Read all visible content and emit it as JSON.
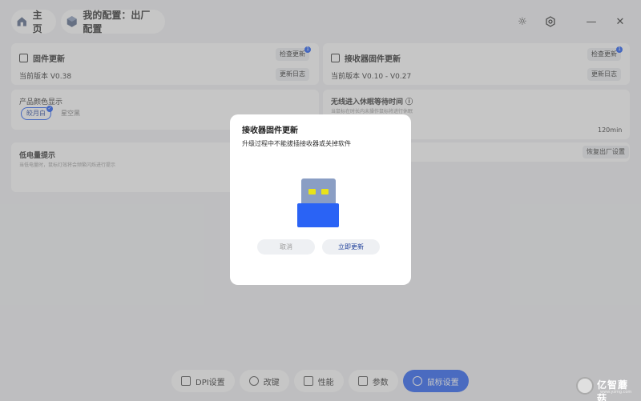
{
  "topbar": {
    "home_label": "主页",
    "config_label": "我的配置：出厂配置",
    "icons": [
      "brightness-icon",
      "settings-icon",
      "minimize-icon",
      "close-icon"
    ],
    "minimize_glyph": "—",
    "close_glyph": "✕",
    "sun_glyph": "☼",
    "gear_glyph": "⚙"
  },
  "firmware": {
    "title": "固件更新",
    "check_label": "检查更新",
    "badge": "1",
    "version": "当前版本 V0.38",
    "log_label": "更新日志"
  },
  "receiver": {
    "title": "接收器固件更新",
    "check_label": "检查更新",
    "badge": "1",
    "version": "当前版本 V0.10 - V0.27",
    "log_label": "更新日志"
  },
  "color_display": {
    "title": "产品颜色显示",
    "options": [
      "皎月白",
      "星空黑"
    ],
    "selected": "皎月白"
  },
  "sleep": {
    "title": "无线进入休眠等待时间",
    "info_glyph": "ⓘ",
    "hint": "当鼠标在时长内未操作鼠标将进行休眠",
    "value": "120min"
  },
  "low_battery": {
    "title": "低电量提示",
    "hint": "当低电量时，鼠标灯效将会频繁闪烁进行提示"
  },
  "reset_label": "恢复出厂设置",
  "bottom_nav": [
    {
      "label": "DPI设置",
      "active": false
    },
    {
      "label": "改键",
      "active": false
    },
    {
      "label": "性能",
      "active": false
    },
    {
      "label": "参数",
      "active": false
    },
    {
      "label": "鼠标设置",
      "active": true
    }
  ],
  "dialog": {
    "title": "接收器固件更新",
    "message": "升级过程中不能拔插接收器或关掉软件",
    "cancel_label": "取消",
    "confirm_label": "立即更新"
  },
  "watermark": {
    "text": "亿智蘑菇",
    "sub": "www.yzmg.com"
  },
  "colors": {
    "accent": "#2a63f5",
    "usb_body": "#2a63f5",
    "usb_plug": "#8a9ec4",
    "usb_led": "#e8e21a"
  }
}
